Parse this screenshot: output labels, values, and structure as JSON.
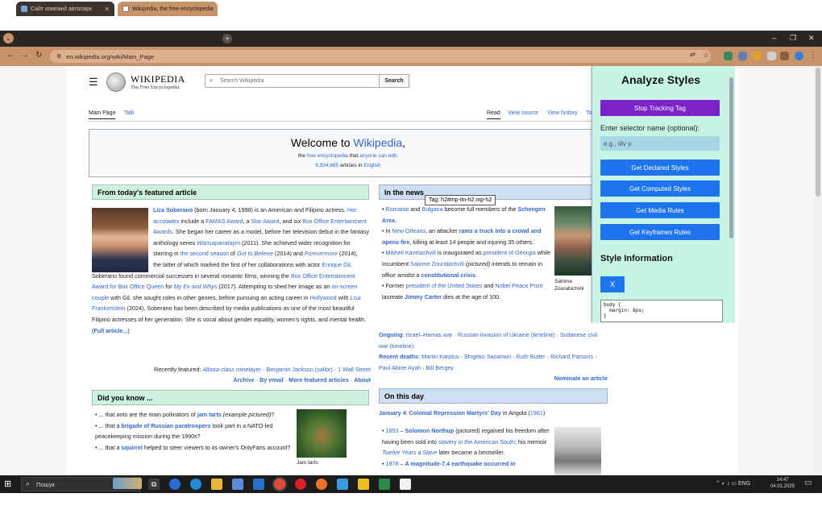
{
  "browser": {
    "tabs": [
      {
        "label": "Сайт компанії автопарк",
        "favicon_color": "#7aa7d9"
      },
      {
        "label": "Wikipedia, the free encyclopedia",
        "favicon_color": "#ffffff"
      }
    ],
    "new_tab_label": "+",
    "url": "en.wikipedia.org/wiki/Main_Page",
    "window_controls": {
      "minimize": "–",
      "restore": "❐",
      "close": "✕"
    },
    "nav": {
      "back": "←",
      "forward": "→",
      "reload": "↻"
    }
  },
  "wikipedia": {
    "logo_wordmark": "WIKIPEDIA",
    "logo_tagline": "The Free Encyclopedia",
    "search_placeholder": "Search Wikipedia",
    "search_button": "Search",
    "tabs_left": [
      "Main Page",
      "Talk"
    ],
    "tabs_right": [
      "Read",
      "View source",
      "View history",
      "To"
    ],
    "welcome_prefix": "Welcome to ",
    "welcome_link": "Wikipedia",
    "welcome_suffix": ",",
    "welcome_sub_1": "the ",
    "welcome_sub_link1": "free encyclopedia",
    "welcome_sub_2": " that ",
    "welcome_sub_link2": "anyone can edit",
    "welcome_sub_3": ".",
    "article_count": "6,934,865",
    "article_count_suffix": " articles in ",
    "article_lang": "English",
    "featured": {
      "heading": "From today's featured article",
      "recently_featured_label": "Recently featured: ",
      "recent_items": [
        "Albora-class minelayer",
        "Benjamin Jackson (sailor)",
        "1 Wall Street"
      ],
      "archive_links": [
        "Archive",
        "By email",
        "More featured articles",
        "About"
      ]
    },
    "news": {
      "heading": "In the news",
      "ongoing_label": "Ongoing",
      "ongoing_items": [
        "Israel–Hamas war",
        "Russian invasion of Ukraine (timeline)",
        "Sudanese civil war (timeline)"
      ],
      "deaths_label": "Recent deaths",
      "deaths_items": [
        "Martin Karplus",
        "Shigeko Sasamori",
        "Ruth Butler",
        "Richard Parsons",
        "Paul Abine Ayah",
        "Bill Bergey"
      ],
      "nominate": "Nominate an article",
      "image_caption": "Salome Zourabichvili"
    },
    "dyk": {
      "heading": "Did you know ...",
      "image_caption": "Jam tarts"
    },
    "otd": {
      "heading": "On this day",
      "date_line": "January 4",
      "date_event": "Colonial Repression Martyrs' Day",
      "date_place": " in Angola (",
      "date_year": "1961",
      "date_close": ")"
    },
    "tooltip": "Tag: h2#mp-itn-h2.mp-h2"
  },
  "panel": {
    "title": "Analyze Styles",
    "stop_button": "Stop Tracking Tag",
    "selector_label": "Enter selector name (optional):",
    "selector_placeholder": "e.g., div p",
    "buttons": [
      "Get Declared Styles",
      "Get Computed Styles",
      "Get Media Rules",
      "Get Keyframes Rules"
    ],
    "info_title": "Style Information",
    "close_button": "X",
    "code": "body {\n  margin: 8px;\n}"
  },
  "taskbar": {
    "search_placeholder": "Пошук",
    "tray_lang": "ENG",
    "time": "14:47",
    "date": "04.01.2025"
  },
  "colors": {
    "panel_bg": "#c6f5e6",
    "panel_button": "#1e74ee",
    "stop_button": "#7b22c9",
    "featured_header": "#cef2e0",
    "news_header": "#cedff2",
    "link": "#3366cc"
  }
}
